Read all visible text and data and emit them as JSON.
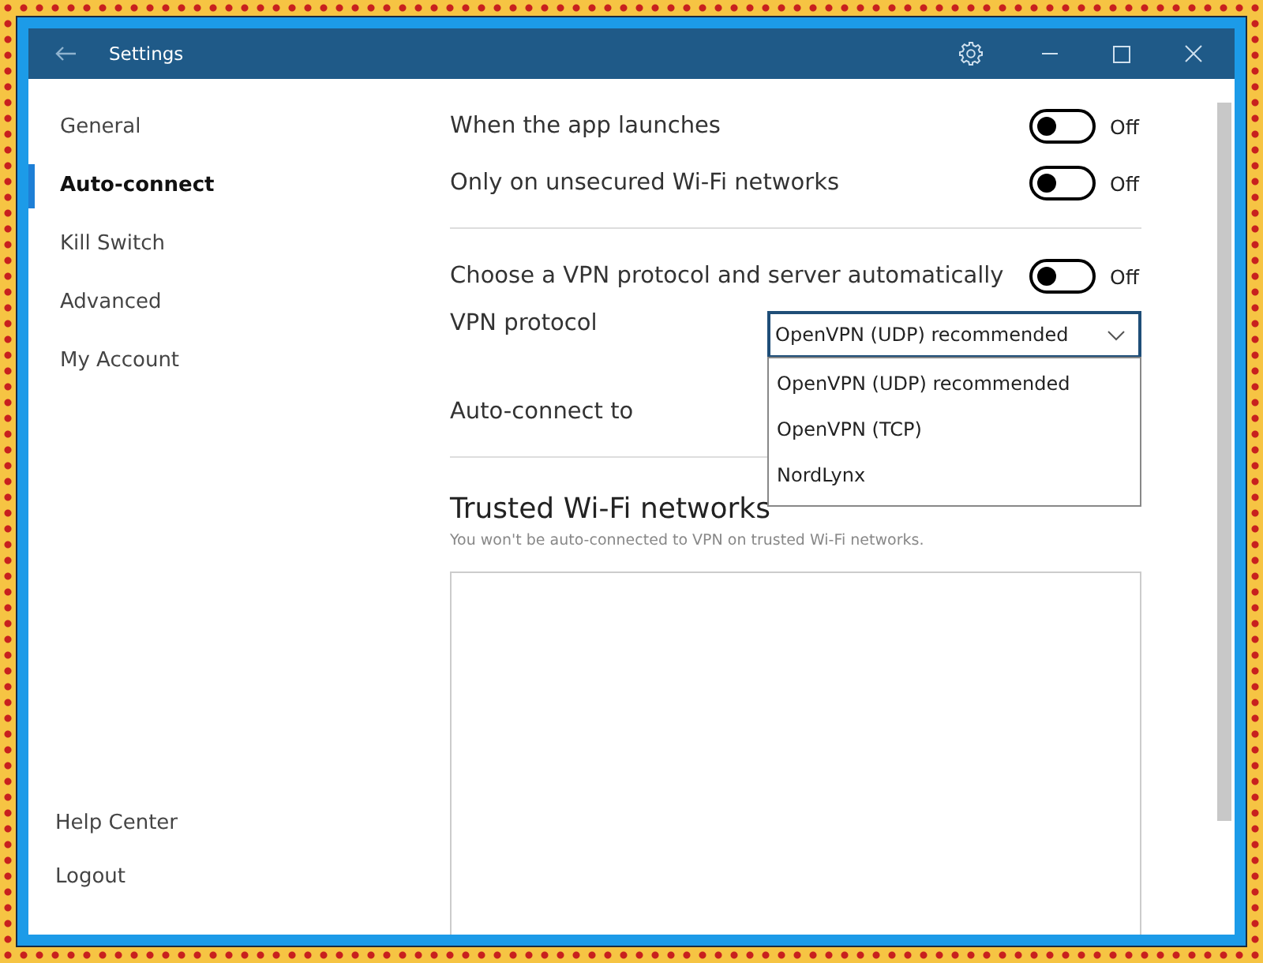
{
  "window": {
    "title": "Settings"
  },
  "sidebar": {
    "items": [
      {
        "label": "General",
        "selected": false
      },
      {
        "label": "Auto-connect",
        "selected": true
      },
      {
        "label": "Kill Switch",
        "selected": false
      },
      {
        "label": "Advanced",
        "selected": false
      },
      {
        "label": "My Account",
        "selected": false
      }
    ],
    "footer_items": [
      "Help Center",
      "Logout"
    ]
  },
  "settings": [
    {
      "kind": "toggle",
      "label": "When the app launches",
      "on": false,
      "state_label": "Off"
    },
    {
      "kind": "toggle",
      "label": "Only on unsecured Wi-Fi networks",
      "on": false,
      "state_label": "Off"
    },
    {
      "kind": "divider"
    },
    {
      "kind": "toggle",
      "label": "Choose a VPN protocol and server automatically",
      "on": false,
      "state_label": "Off"
    },
    {
      "kind": "dropdown",
      "label": "VPN protocol",
      "value": "OpenVPN (UDP) recommended",
      "expanded": true,
      "options": [
        "OpenVPN (UDP) recommended",
        "OpenVPN (TCP)",
        "NordLynx"
      ]
    },
    {
      "kind": "label",
      "label": "Auto-connect to"
    },
    {
      "kind": "divider"
    }
  ],
  "trusted": {
    "title": "Trusted Wi-Fi networks",
    "subtitle": "You won't be auto-connected to VPN on trusted Wi-Fi networks."
  }
}
